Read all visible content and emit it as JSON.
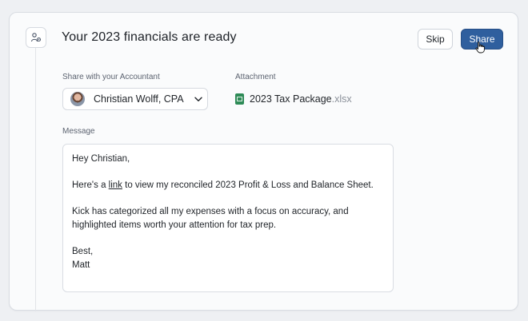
{
  "title": "Your 2023 financials are ready",
  "actions": {
    "skip_label": "Skip",
    "share_label": "Share"
  },
  "share": {
    "label": "Share with your Accountant",
    "accountant_name": "Christian Wolff, CPA"
  },
  "attachment": {
    "label": "Attachment",
    "file_base": "2023 Tax Package",
    "file_ext": ".xlsx"
  },
  "message": {
    "label": "Message",
    "greeting": "Hey Christian,",
    "p1_before": "Here's a ",
    "p1_link": "link",
    "p1_after": " to view my reconciled 2023 Profit & Loss and Balance Sheet.",
    "p2": "Kick has categorized all my expenses with a focus on accuracy, and highlighted items worth your attention for tax prep.",
    "signoff": "Best,",
    "signature": "Matt"
  },
  "colors": {
    "primary_button": "#2f5f9e",
    "excel_icon": "#2e8b57"
  },
  "icons": {
    "step": "user-settings-icon",
    "dropdown": "chevron-down-icon",
    "file": "excel-file-icon",
    "cursor": "hand-pointer-icon"
  }
}
